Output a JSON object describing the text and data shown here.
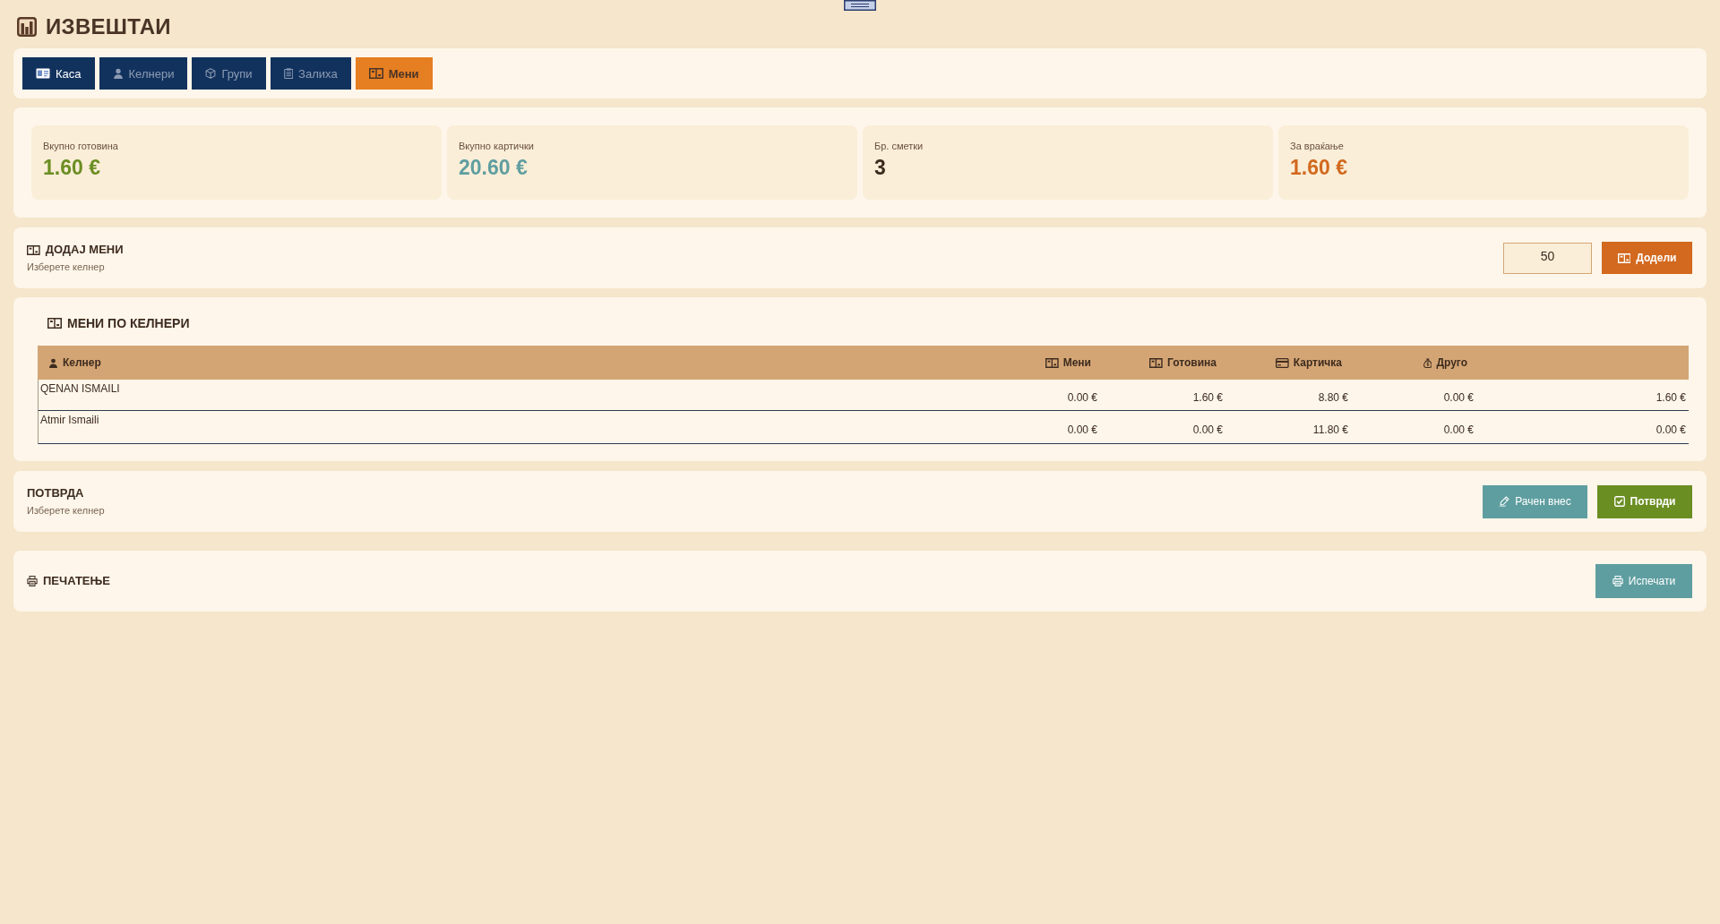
{
  "page": {
    "title": "ИЗВЕШТАИ"
  },
  "tabs": [
    {
      "label": "Каса",
      "selected": false,
      "disabled": false
    },
    {
      "label": "Келнери",
      "selected": false,
      "disabled": true
    },
    {
      "label": "Групи",
      "selected": false,
      "disabled": true
    },
    {
      "label": "Залиха",
      "selected": false,
      "disabled": true
    },
    {
      "label": "Мени",
      "selected": true,
      "disabled": false
    }
  ],
  "summary": [
    {
      "label": "Вкупно готовина",
      "value": "1.60 €",
      "color": "#6b8e23"
    },
    {
      "label": "Вкупно картички",
      "value": "20.60 €",
      "color": "#5f9ea0"
    },
    {
      "label": "Бр. сметки",
      "value": "3",
      "color": "#3d2b1f"
    },
    {
      "label": "За враќање",
      "value": "1.60 €",
      "color": "#d2691e"
    }
  ],
  "add_menu": {
    "title": "ДОДАЈ МЕНИ",
    "subtitle": "Изберете келнер",
    "amount": "50",
    "button": "Додели"
  },
  "menus_by_waiter": {
    "title": "МЕНИ ПО КЕЛНЕРИ",
    "columns": [
      "Келнер",
      "Мени",
      "Готовина",
      "Картичка",
      "Друго"
    ],
    "rows": [
      {
        "cells": [
          "QENAN ISMAILI",
          "0.00 €",
          "1.60 €",
          "8.80 €",
          "0.00 €",
          "1.60 €"
        ]
      },
      {
        "cells": [
          "Atmir Ismaili",
          "0.00 €",
          "0.00 €",
          "11.80 €",
          "0.00 €",
          "0.00 €"
        ]
      }
    ]
  },
  "confirmation": {
    "title": "ПОТВРДА",
    "subtitle": "Изберете келнер",
    "buttons": [
      {
        "label": "Рачен внес",
        "kind": "manual"
      },
      {
        "label": "Потврди",
        "kind": "confirm"
      }
    ]
  },
  "printing": {
    "title": "ПЕЧАТЕЊЕ",
    "button": "Испечати"
  }
}
